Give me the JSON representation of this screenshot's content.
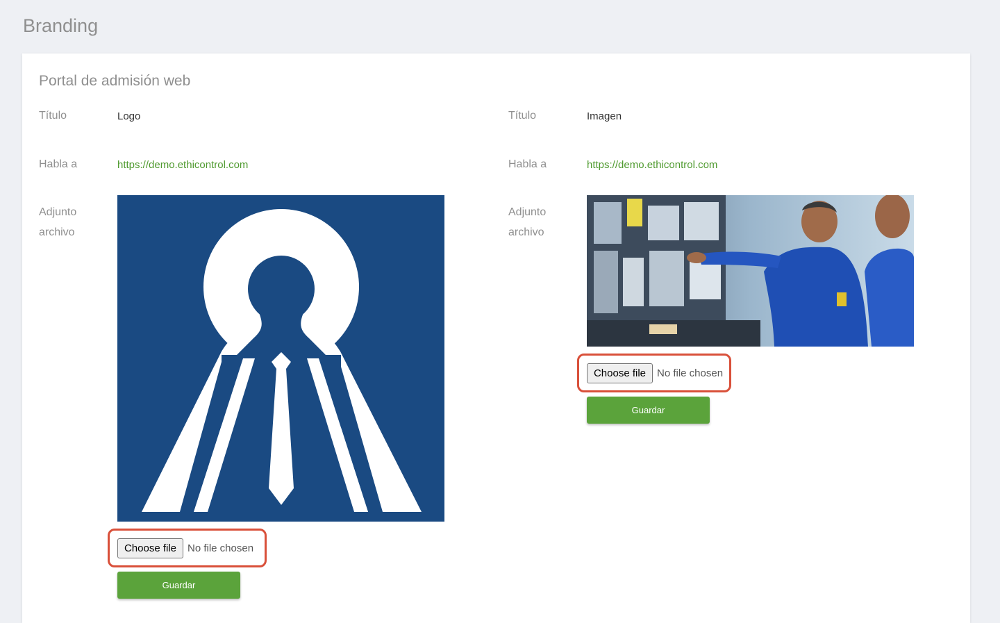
{
  "page": {
    "title": "Branding"
  },
  "section": {
    "title": "Portal de admisión web"
  },
  "left": {
    "title_label": "Título",
    "title_value": "Logo",
    "link_label": "Habla a",
    "link_value": "https://demo.ethicontrol.com",
    "attach_label_1": "Adjunto",
    "attach_label_2": "archivo",
    "file_button": "Choose file",
    "file_status": "No file chosen",
    "save_label": "Guardar"
  },
  "right": {
    "title_label": "Título",
    "title_value": "Imagen",
    "link_label": "Habla a",
    "link_value": "https://demo.ethicontrol.com",
    "attach_label_1": "Adjunto",
    "attach_label_2": "archivo",
    "file_button": "Choose file",
    "file_status": "No file chosen",
    "save_label": "Guardar"
  },
  "colors": {
    "background": "#eef0f4",
    "link": "#4f9a2f",
    "save_button": "#5ba33b",
    "highlight": "#d9503a",
    "logo_blue": "#1a4a82"
  },
  "icons": {
    "logo_image": "person-keyhole-logo",
    "photo_image": "control-room-photo"
  }
}
